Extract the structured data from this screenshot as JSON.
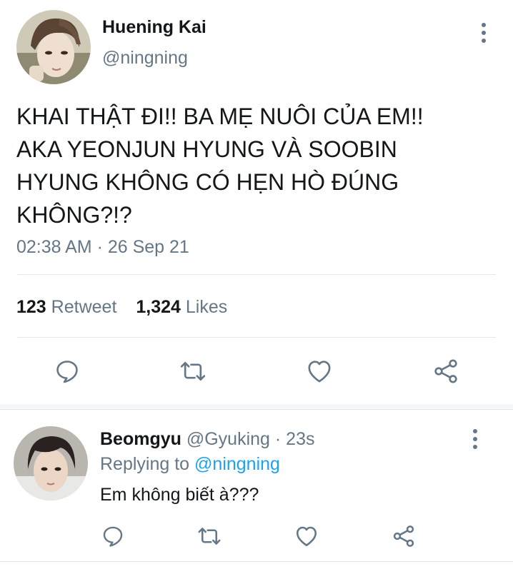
{
  "main_tweet": {
    "display_name": "Huening Kai",
    "handle": "@ningning",
    "text_lines": [
      "KHAI THẬT ĐI!! BA MẸ NUÔI CỦA EM!!",
      "AKA YEONJUN HYUNG VÀ SOOBIN",
      "HYUNG KHÔNG CÓ HẸN HÒ ĐÚNG",
      "KHÔNG?!?"
    ],
    "timestamp": "02:38 AM · 26 Sep 21",
    "stats": {
      "retweet_count": "123",
      "retweet_label": "Retweet",
      "likes_count": "1,324",
      "likes_label": "Likes"
    }
  },
  "reply": {
    "display_name": "Beomgyu",
    "handle": "@Gyuking",
    "separator": " · ",
    "age": "23s",
    "replying_prefix": "Replying to",
    "replying_to": "@ningning",
    "text": "Em không biết à???"
  },
  "icons": {
    "reply": "comment-icon",
    "retweet": "retweet-icon",
    "like": "heart-icon",
    "share": "share-icon",
    "more": "more-vertical-icon"
  },
  "colors": {
    "text": "#14171a",
    "muted": "#657786",
    "link": "#1da1f2",
    "divider": "#e1e8ed"
  }
}
